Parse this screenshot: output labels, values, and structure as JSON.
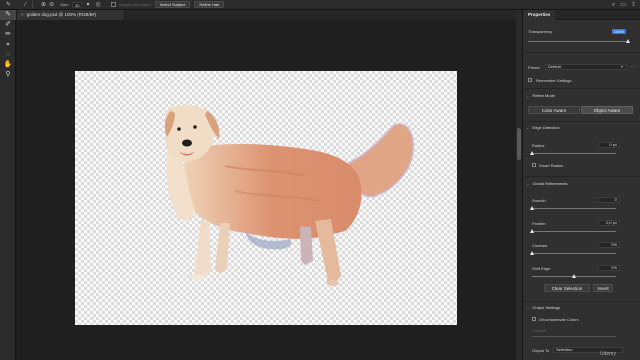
{
  "options_bar": {
    "size_label": "Size:",
    "size_value": "30",
    "sample_all_layers": "Sample All Layers",
    "select_subject": "Select Subject",
    "refine_hair": "Refine Hair"
  },
  "document": {
    "tab_title": "golden dog.psd @ 100% (RGB/8#)"
  },
  "panel": {
    "tab": "Properties",
    "transparency_label": "Transparency",
    "transparency_value": "100%",
    "transparency_level": 1.0,
    "preset_label": "Preset",
    "preset_value": "Default",
    "remember_settings": "Remember Settings",
    "refine_mode": {
      "title": "Refine Mode",
      "color_aware": "Color Aware",
      "object_aware": "Object Aware",
      "selected": "Object Aware"
    },
    "edge_detection": {
      "title": "Edge Detection",
      "radius_label": "Radius",
      "radius_value": "0 px",
      "radius_level": 0.0,
      "smart_radius": "Smart Radius"
    },
    "global_refinements": {
      "title": "Global Refinements",
      "smooth_label": "Smooth",
      "smooth_value": "0",
      "smooth_level": 0.0,
      "feather_label": "Feather",
      "feather_value": "0,0 px",
      "feather_level": 0.0,
      "contrast_label": "Contrast",
      "contrast_value": "0%",
      "contrast_level": 0.0,
      "shift_edge_label": "Shift Edge",
      "shift_edge_value": "0%",
      "shift_edge_level": 0.5,
      "clear_selection": "Clear Selection",
      "invert": "Invert"
    },
    "output_settings": {
      "title": "Output Settings",
      "decontaminate": "Decontaminate Colors",
      "amount_label": "Amount",
      "output_to_label": "Output To",
      "output_to_value": "Selection"
    }
  },
  "watermark": "Udemy",
  "icons": {
    "tools": [
      "quick-selection-icon",
      "refine-edge-brush-icon",
      "brush-icon",
      "object-selection-icon",
      "lasso-icon",
      "hand-icon",
      "zoom-icon"
    ]
  }
}
